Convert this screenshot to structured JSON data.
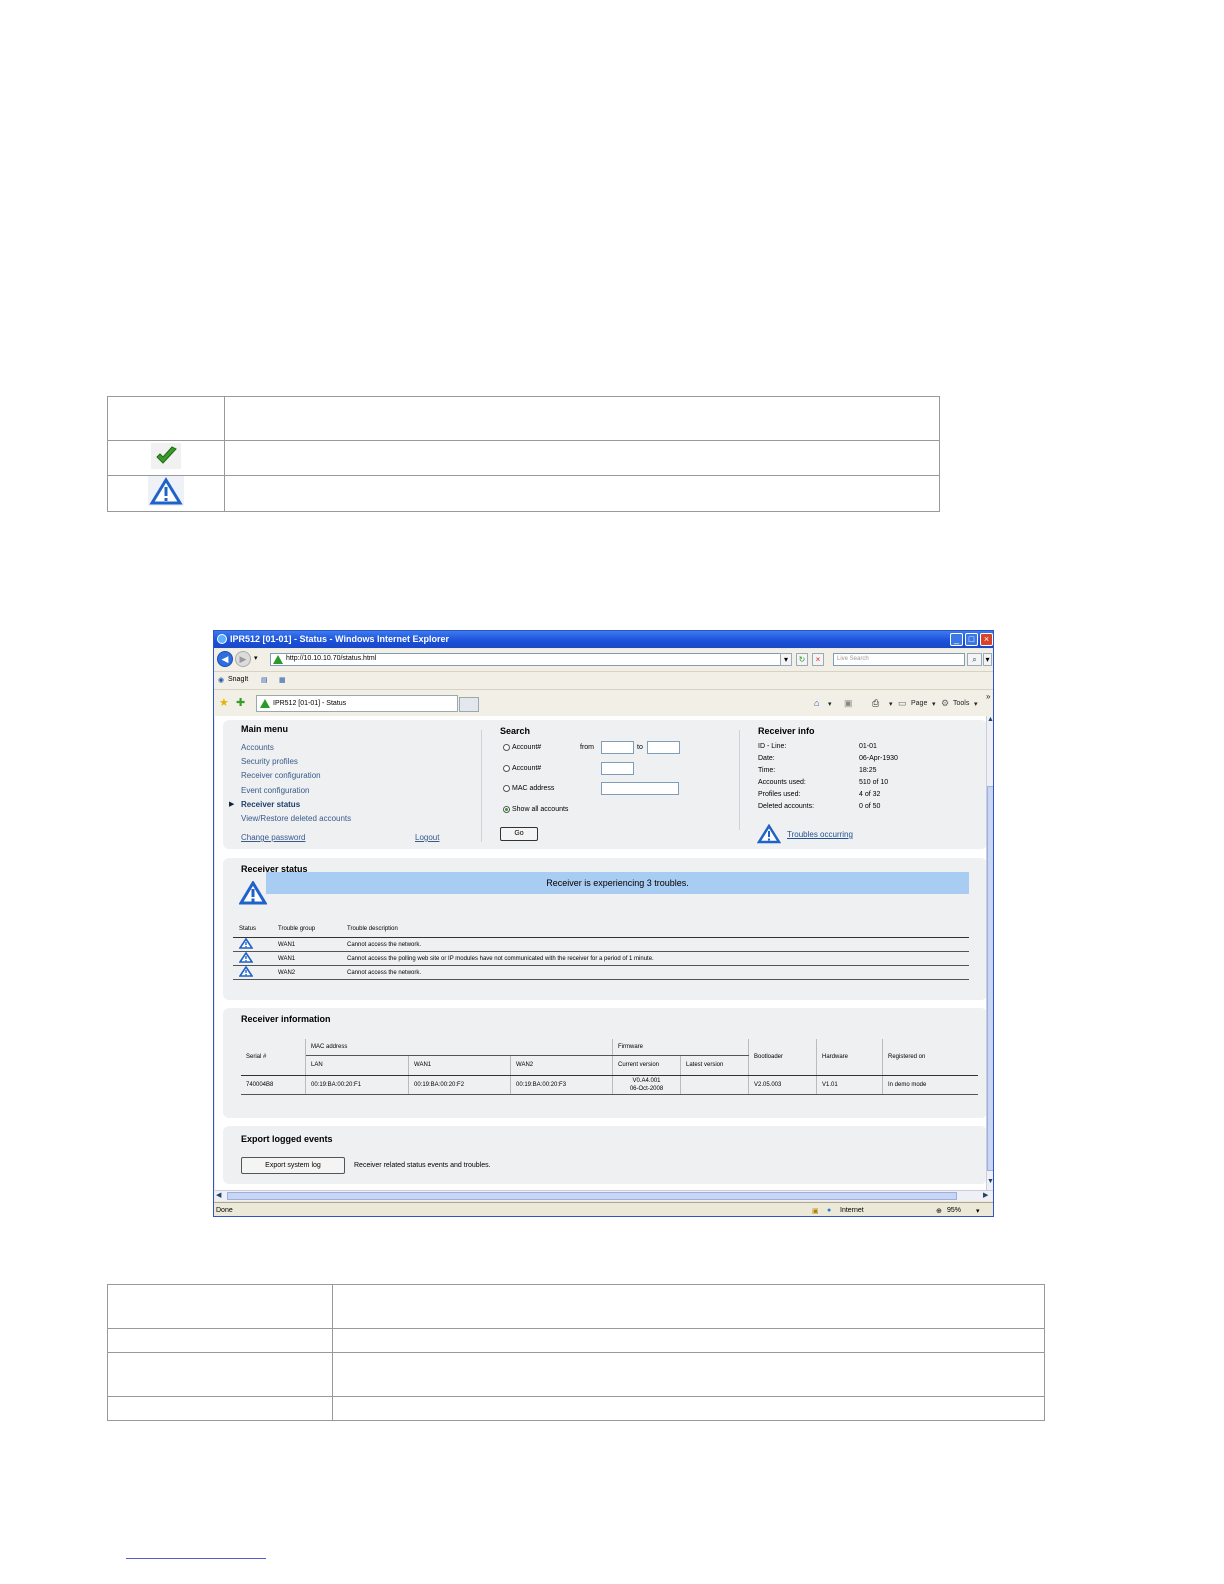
{
  "browser": {
    "title": "IPR512 [01-01] - Status - Windows Internet Explorer",
    "url": "http://10.10.10.70/status.html",
    "search_placeholder": "Live Search",
    "snagit_label": "SnagIt",
    "tab_label": "IPR512 [01-01] - Status",
    "page_menu": "Page",
    "tools_menu": "Tools",
    "status_text": "Done",
    "zone": "Internet",
    "zoom": "95%"
  },
  "main_menu": {
    "title": "Main menu",
    "items": [
      "Accounts",
      "Security profiles",
      "Receiver configuration",
      "Event configuration",
      "Receiver status",
      "View/Restore deleted accounts"
    ],
    "active_item": "Receiver status",
    "change_password": "Change password",
    "logout": "Logout"
  },
  "search": {
    "title": "Search",
    "options": [
      "Account#",
      "Account#",
      "MAC address",
      "Show all accounts"
    ],
    "from_label": "from",
    "to_label": "to",
    "go_label": "Go"
  },
  "receiver_info": {
    "title": "Receiver info",
    "rows": [
      {
        "label": "ID - Line:",
        "value": "01-01"
      },
      {
        "label": "Date:",
        "value": "06-Apr-1930"
      },
      {
        "label": "Time:",
        "value": "18:25"
      },
      {
        "label": "Accounts used:",
        "value": "510 of 10"
      },
      {
        "label": "Profiles used:",
        "value": "4 of 32"
      },
      {
        "label": "Deleted accounts:",
        "value": "0 of 50"
      }
    ],
    "troubles_link": "Troubles occurring"
  },
  "receiver_status": {
    "title": "Receiver status",
    "banner": "Receiver is experiencing 3 troubles.",
    "headers": [
      "Status",
      "Trouble group",
      "Trouble description"
    ],
    "rows": [
      {
        "group": "WAN1",
        "description": "Cannot access the network."
      },
      {
        "group": "WAN1",
        "description": "Cannot access the polling web site or IP modules have not communicated with the receiver for a period of 1 minute."
      },
      {
        "group": "WAN2",
        "description": "Cannot access the network."
      }
    ]
  },
  "receiver_information": {
    "title": "Receiver information",
    "headers": {
      "serial": "Serial #",
      "mac": "MAC address",
      "lan": "LAN",
      "wan1": "WAN1",
      "wan2": "WAN2",
      "firmware": "Firmware",
      "current": "Current version",
      "latest": "Latest version",
      "bootloader": "Bootloader",
      "hardware": "Hardware",
      "registered": "Registered on"
    },
    "row": {
      "serial": "740004B8",
      "lan": "00:19:BA:00:20:F1",
      "wan1": "00:19:BA:00:20:F2",
      "wan2": "00:19:BA:00:20:F3",
      "current_version": "V0.A4.001",
      "current_date": "06-Oct-2008",
      "latest": "",
      "bootloader": "V2.05.003",
      "hardware": "V1.01",
      "registered": "In demo mode"
    }
  },
  "export": {
    "title": "Export logged events",
    "button": "Export system log",
    "description": "Receiver related status events and troubles."
  },
  "colors": {
    "ok_icon": "#3a9a2a",
    "warning_icon": "#1f63c8",
    "banner": "#a9cdf2"
  }
}
